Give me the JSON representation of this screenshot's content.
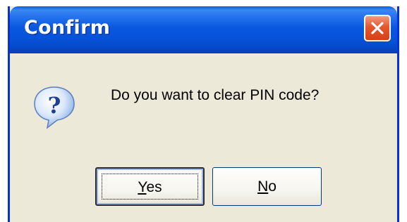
{
  "window": {
    "title": "Confirm",
    "close_icon": "close-icon"
  },
  "dialog": {
    "icon": "question-icon",
    "message": "Do you want to clear PIN code?"
  },
  "buttons": {
    "yes": {
      "mnemonic": "Y",
      "rest": "es"
    },
    "no": {
      "mnemonic": "N",
      "rest": "o"
    }
  },
  "colors": {
    "titlebar": "#0a58e0",
    "body": "#ece9d8",
    "close_button": "#e5572f"
  }
}
